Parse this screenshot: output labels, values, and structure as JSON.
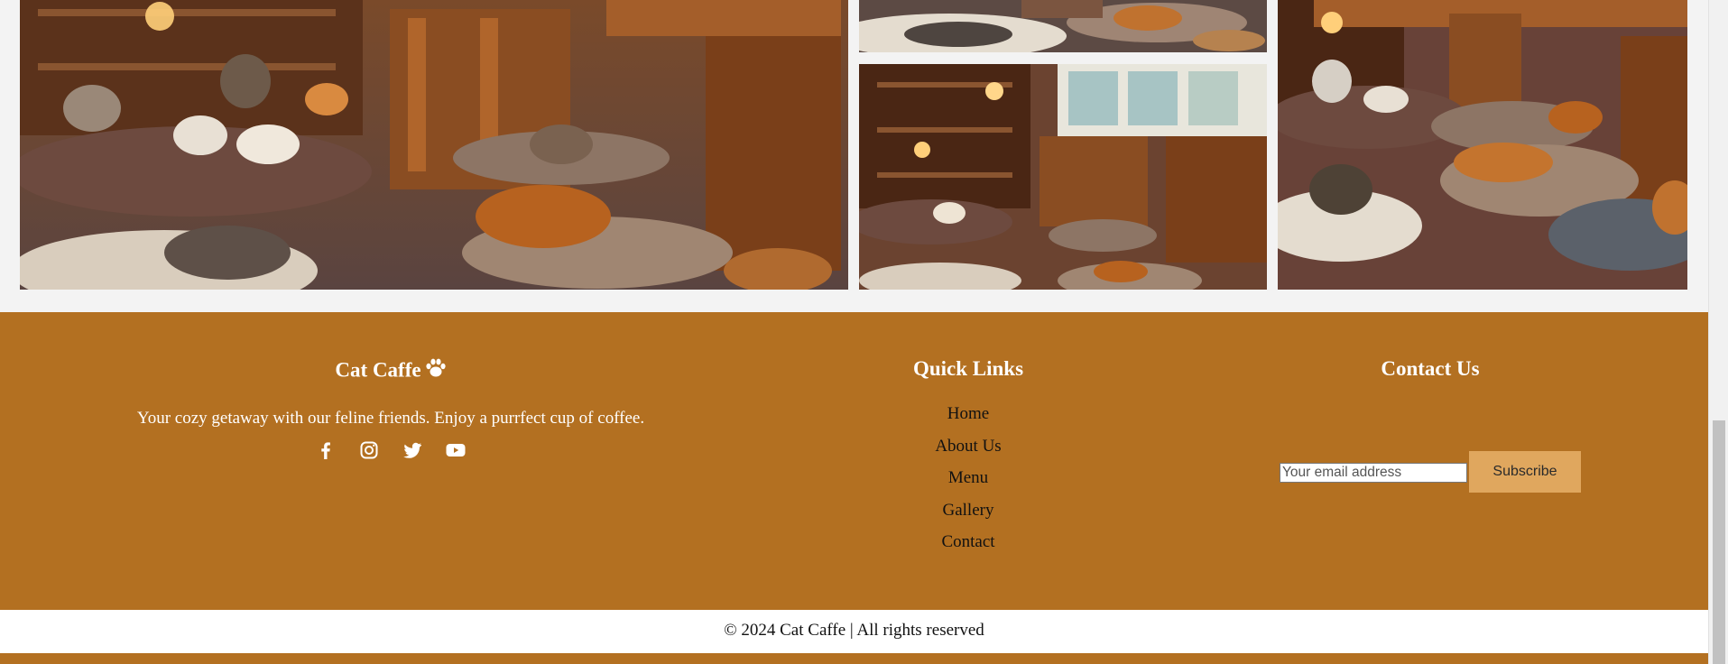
{
  "gallery": {
    "images": [
      {
        "icon": "cat-cafe-photo"
      },
      {
        "icon": "cat-cafe-photo"
      },
      {
        "icon": "cat-cafe-photo"
      },
      {
        "icon": "cat-cafe-photo"
      }
    ]
  },
  "footer": {
    "about": {
      "title": "Cat Caffe",
      "title_icon": "paw-icon",
      "tagline": "Your cozy getaway with our feline friends. Enjoy a purrfect cup of coffee.",
      "social": [
        "facebook-icon",
        "instagram-icon",
        "twitter-icon",
        "youtube-icon"
      ]
    },
    "quick_links": {
      "title": "Quick Links",
      "items": [
        "Home",
        "About Us",
        "Menu",
        "Gallery",
        "Contact"
      ]
    },
    "contact": {
      "title": "Contact Us",
      "email_placeholder": "Your email address",
      "email_value": "",
      "subscribe_label": "Subscribe"
    }
  },
  "copyright": "© 2024 Cat Caffe | All rights reserved",
  "colors": {
    "footer_bg": "#b37021",
    "button_bg": "#e0a75e",
    "page_bg": "#f3f3f3"
  }
}
